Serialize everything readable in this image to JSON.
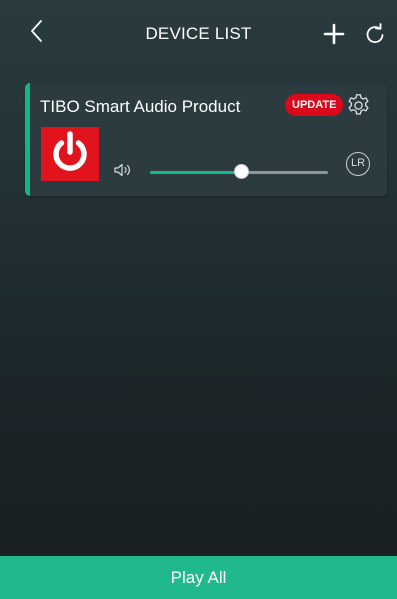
{
  "header": {
    "title": "DEVICE LIST",
    "back_icon": "chevron-left-icon",
    "add_icon": "plus-icon",
    "refresh_icon": "refresh-icon"
  },
  "device": {
    "name": "TIBO Smart Audio Product",
    "update_label": "UPDATE",
    "settings_icon": "gear-icon",
    "power_icon": "power-icon",
    "volume_icon": "speaker-icon",
    "volume_level_percent": 51,
    "channel_label": "LR"
  },
  "footer": {
    "play_all_label": "Play All"
  },
  "colors": {
    "accent": "#20b88d",
    "power": "#e1131c",
    "update_badge": "#d9081a"
  }
}
